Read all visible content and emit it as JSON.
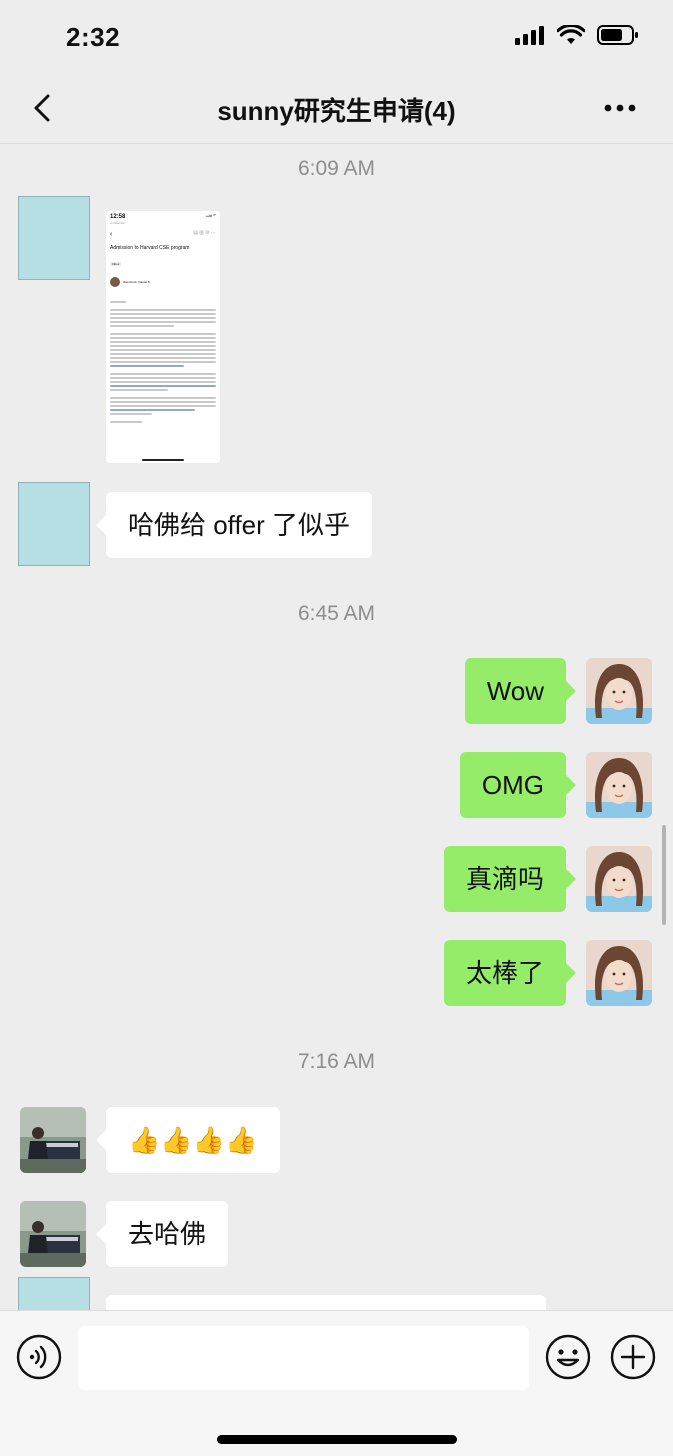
{
  "status_bar": {
    "time": "2:32"
  },
  "nav": {
    "title": "sunny研究生申请(4)"
  },
  "messages": {
    "ts1": "6:09 AM",
    "email_shot": {
      "time": "12:58",
      "back_app": "◂ Calendar",
      "subject": "Admission to Harvard CSE program",
      "tag": "Inbox",
      "sender": "Weinstock, Daniel S"
    },
    "m2": "哈佛给 offer 了似乎",
    "ts2": "6:45 AM",
    "m3": "Wow",
    "m4": "OMG",
    "m5": "真滴吗",
    "m6": "太棒了",
    "ts3": "7:16 AM",
    "m7": "👍👍👍👍",
    "m8": "去哈佛"
  },
  "input": {
    "placeholder": ""
  },
  "icons": {
    "back": "chevron-left-icon",
    "more": "more-dots-icon",
    "voice": "voice-icon",
    "emoji": "emoji-icon",
    "plus": "plus-icon"
  },
  "colors": {
    "outgoing_bubble": "#95ec69",
    "incoming_bubble": "#ffffff",
    "background": "#ededed"
  }
}
